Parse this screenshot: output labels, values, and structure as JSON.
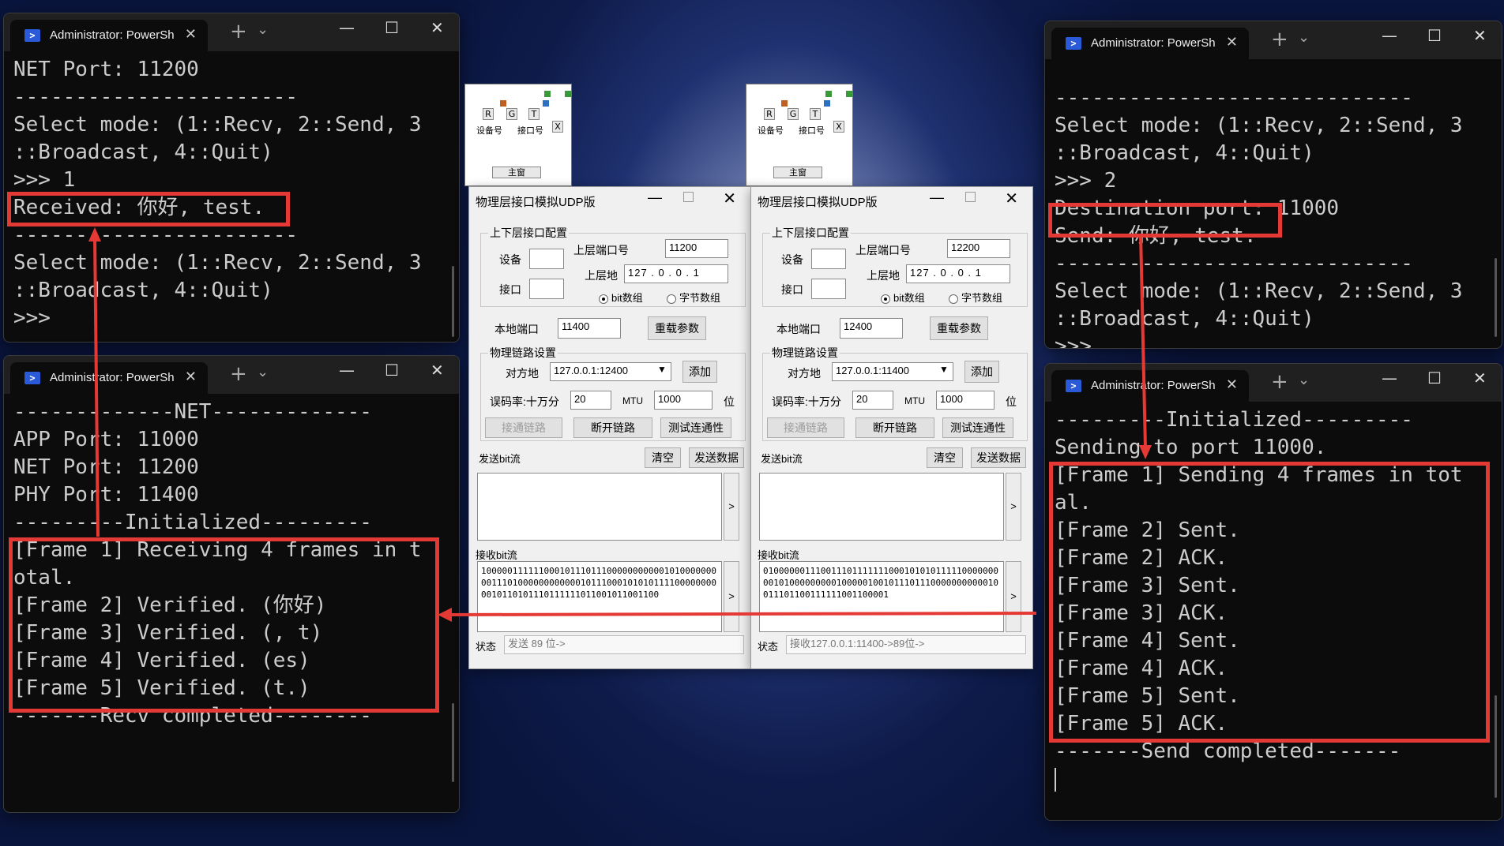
{
  "terminals": {
    "top_left": {
      "tab_title": "Administrator: PowerSh",
      "lines": [
        "NET Port: 11200",
        "-----------------------",
        "Select mode: (1::Recv, 2::Send, 3",
        "::Broadcast, 4::Quit)",
        ">>> 1",
        "Received: 你好, test.",
        "-----------------------",
        "Select mode: (1::Recv, 2::Send, 3",
        "::Broadcast, 4::Quit)",
        ">>>"
      ]
    },
    "bottom_left": {
      "tab_title": "Administrator: PowerSh",
      "lines": [
        "-------------NET-------------",
        "APP Port: 11000",
        "NET Port: 11200",
        "PHY Port: 11400",
        "---------Initialized---------",
        "[Frame 1] Receiving 4 frames in t",
        "otal.",
        "[Frame 2] Verified. (你好)",
        "[Frame 3] Verified. (, t)",
        "[Frame 4] Verified. (es)",
        "[Frame 5] Verified. (t.)",
        "-------Recv completed--------"
      ]
    },
    "top_right": {
      "tab_title": "Administrator: PowerSh",
      "lines": [
        "-----------------------------",
        "Select mode: (1::Recv, 2::Send, 3",
        "::Broadcast, 4::Quit)",
        ">>> 2",
        "Destination port: 11000",
        "Send: 你好, test.",
        "-----------------------------",
        "Select mode: (1::Recv, 2::Send, 3",
        "::Broadcast, 4::Quit)",
        ">>>"
      ]
    },
    "bottom_right": {
      "tab_title": "Administrator: PowerSh",
      "lines": [
        "---------Initialized---------",
        "Sending to port 11000.",
        "[Frame 1] Sending 4 frames in tot",
        "al.",
        "[Frame 2] Sent.",
        "[Frame 2] ACK.",
        "[Frame 3] Sent.",
        "[Frame 3] ACK.",
        "[Frame 4] Sent.",
        "[Frame 4] ACK.",
        "[Frame 5] Sent.",
        "[Frame 5] ACK.",
        "-------Send completed-------"
      ]
    }
  },
  "dialogs": {
    "left": {
      "title": "物理层接口模拟UDP版",
      "group_updown": "上下层接口配置",
      "device_label": "设备",
      "iface_label": "接口",
      "upper_port_label": "上层端口号",
      "upper_port": "11200",
      "upper_addr_label": "上层地",
      "upper_addr": "127 . 0 . 0 . 1",
      "radio_bit": "bit数组",
      "radio_byte": "字节数组",
      "local_port_label": "本地端口",
      "local_port": "11400",
      "reload_btn": "重载参数",
      "group_link": "物理链路设置",
      "peer_label": "对方地",
      "peer_value": "127.0.0.1:12400",
      "add_btn": "添加",
      "ber_label": "误码率:十万分",
      "ber_value": "20",
      "mtu_label": "MTU",
      "mtu_value": "1000",
      "bit_unit": "位",
      "connect_btn": "接通链路",
      "disconnect_btn": "断开链路",
      "test_btn": "测试连通性",
      "send_label": "发送bit流",
      "clear_btn": "清空",
      "send_btn": "发送数据",
      "recv_label": "接收bit流",
      "recv_bits": "1000001111110001011101110000000000010100000000011101000000000000101110001010101111000000000010110101110111111011001011001100",
      "side_btn": ">",
      "status_label": "状态",
      "status_text": "发送 89 位->"
    },
    "right": {
      "title": "物理层接口模拟UDP版",
      "group_updown": "上下层接口配置",
      "device_label": "设备",
      "iface_label": "接口",
      "upper_port_label": "上层端口号",
      "upper_port": "12200",
      "upper_addr_label": "上层地",
      "upper_addr": "127 . 0 . 0 . 1",
      "radio_bit": "bit数组",
      "radio_byte": "字节数组",
      "local_port_label": "本地端口",
      "local_port": "12400",
      "reload_btn": "重载参数",
      "group_link": "物理链路设置",
      "peer_label": "对方地",
      "peer_value": "127.0.0.1:11400",
      "add_btn": "添加",
      "ber_label": "误码率:十万分",
      "ber_value": "20",
      "mtu_label": "MTU",
      "mtu_value": "1000",
      "bit_unit": "位",
      "connect_btn": "接通链路",
      "disconnect_btn": "断开链路",
      "test_btn": "测试连通性",
      "send_label": "发送bit流",
      "clear_btn": "清空",
      "send_btn": "发送数据",
      "recv_label": "接收bit流",
      "recv_bits": "010000001110011101111111000101010111110000000001010000000001000001001011101110000000000010011101100111111001100001",
      "side_btn": ">",
      "status_label": "状态",
      "status_text": "接收127.0.0.1:11400->89位->"
    }
  },
  "mini_windows": {
    "buttons": [
      "R",
      "G",
      "T",
      "X"
    ],
    "device_label": "设备号",
    "iface_label": "接口号",
    "main_label": "主窗"
  },
  "colors": {
    "highlight": "#e53935",
    "terminal_bg": "#0c0c0c",
    "terminal_text": "#cccccc"
  }
}
